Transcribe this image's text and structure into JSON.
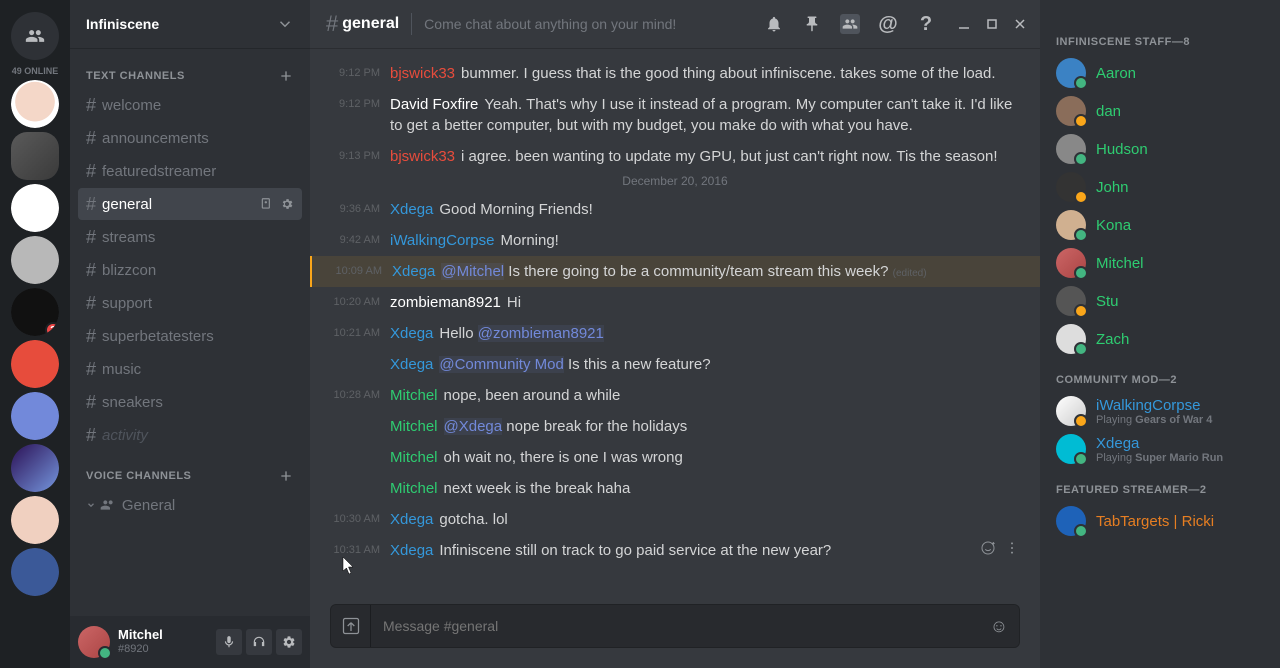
{
  "colors": {
    "role_staff": "#2ecc71",
    "role_mod": "#3498db",
    "role_red": "#e74c3c",
    "role_white": "#ffffff",
    "role_teal": "#1abc9c",
    "role_featured": "#e67e22"
  },
  "server_bar": {
    "online_label": "49 ONLINE",
    "servers": [
      {
        "id": "home",
        "color": "#2e3136",
        "is_home": true
      },
      {
        "id": "isaac",
        "color": "radial-gradient(circle at 50% 45%, #f4d7c8 55%, #fff 56%)",
        "active": false
      },
      {
        "id": "infiniscene",
        "color": "linear-gradient(135deg, #5a5a5a, #3a3a3a)",
        "active": true
      },
      {
        "id": "filthy",
        "color": "#ffffff"
      },
      {
        "id": "asharias",
        "color": "#b8b8b8"
      },
      {
        "id": "moon",
        "color": "#111",
        "badge": "2"
      },
      {
        "id": "axe",
        "color": "#e74c3c"
      },
      {
        "id": "partner",
        "color": "#7289da"
      },
      {
        "id": "galaxy",
        "color": "linear-gradient(135deg, #2b1055, #7597de)"
      },
      {
        "id": "eyes",
        "color": "#f0d0c0"
      },
      {
        "id": "blue",
        "color": "#3b5998"
      }
    ]
  },
  "channel_panel": {
    "server_name": "Infiniscene",
    "text_label": "TEXT CHANNELS",
    "voice_label": "VOICE CHANNELS",
    "channels": [
      {
        "name": "welcome"
      },
      {
        "name": "announcements"
      },
      {
        "name": "featuredstreamer"
      },
      {
        "name": "general",
        "active": true
      },
      {
        "name": "streams"
      },
      {
        "name": "blizzcon"
      },
      {
        "name": "support"
      },
      {
        "name": "superbetatesters"
      },
      {
        "name": "music"
      },
      {
        "name": "sneakers"
      },
      {
        "name": "activity",
        "muted": true
      }
    ],
    "voice_channels": [
      {
        "name": "General"
      }
    ],
    "user": {
      "name": "Mitchel",
      "tag": "#8920"
    }
  },
  "chat_header": {
    "channel": "general",
    "topic": "Come chat about anything on your mind!"
  },
  "messages": [
    {
      "time": "9:12 PM",
      "author": "bjswick33",
      "color": "role_red",
      "text": "bummer.   I guess that is the good thing about infiniscene.  takes some of the load."
    },
    {
      "time": "9:12 PM",
      "author": "David Foxfire",
      "color": "role_white",
      "text": "Yeah.  That's why I use it instead of a program.  My computer can't take it.  I'd like to get a better computer, but with my budget, you make do with what you have."
    },
    {
      "time": "9:13 PM",
      "author": "bjswick33",
      "color": "role_red",
      "text": "i agree.  been wanting to update my GPU, but just can't right now.  Tis the season!"
    },
    {
      "divider": "December 20, 2016"
    },
    {
      "time": "9:36 AM",
      "author": "Xdega",
      "color": "role_mod",
      "text": "Good Morning Friends!"
    },
    {
      "time": "9:42 AM",
      "author": "iWalkingCorpse",
      "color": "role_mod",
      "text": "Morning!"
    },
    {
      "time": "10:09 AM",
      "author": "Xdega",
      "color": "role_mod",
      "mention": "@Mitchel",
      "text": " Is there going to be a community/team stream this week?",
      "edited": true,
      "highlight": true
    },
    {
      "time": "10:20 AM",
      "author": "zombieman8921",
      "color": "role_white",
      "text": "Hi"
    },
    {
      "time": "10:21 AM",
      "author": "Xdega",
      "color": "role_mod",
      "text": "Hello ",
      "mention_after": "@zombieman8921"
    },
    {
      "time": "",
      "author": "Xdega",
      "color": "role_mod",
      "mention": "@Community Mod",
      "text": " Is this a new feature?"
    },
    {
      "time": "10:28 AM",
      "author": "Mitchel",
      "color": "role_staff",
      "text": "nope, been around a while"
    },
    {
      "time": "",
      "author": "Mitchel",
      "color": "role_staff",
      "mention": "@Xdega",
      "text": " nope break for the holidays"
    },
    {
      "time": "",
      "author": "Mitchel",
      "color": "role_staff",
      "text": "oh wait no, there is one I was wrong"
    },
    {
      "time": "",
      "author": "Mitchel",
      "color": "role_staff",
      "text": "next week is the break haha"
    },
    {
      "time": "10:30 AM",
      "author": "Xdega",
      "color": "role_mod",
      "text": "gotcha. lol"
    },
    {
      "time": "10:31 AM",
      "author": "Xdega",
      "color": "role_mod",
      "text": "Infiniscene still on track to go paid service at the new year?",
      "actions": true
    }
  ],
  "input_placeholder": "Message #general",
  "members": {
    "sections": [
      {
        "title": "INFINISCENE STAFF—8",
        "color": "role_staff",
        "members": [
          {
            "name": "Aaron",
            "avatar": "#3b82c4"
          },
          {
            "name": "dan",
            "avatar": "#8a6d5a",
            "status": "idle"
          },
          {
            "name": "Hudson",
            "avatar": "#888"
          },
          {
            "name": "John",
            "avatar": "#333",
            "status": "idle"
          },
          {
            "name": "Kona",
            "avatar": "#d0b090"
          },
          {
            "name": "Mitchel",
            "avatar": "linear-gradient(135deg, #c66, #a44)"
          },
          {
            "name": "Stu",
            "avatar": "#555",
            "status": "idle"
          },
          {
            "name": "Zach",
            "avatar": "#ddd"
          }
        ]
      },
      {
        "title": "COMMUNITY MOD—2",
        "color": "role_mod",
        "members": [
          {
            "name": "iWalkingCorpse",
            "avatar": "linear-gradient(135deg,#fff,#ccc)",
            "status": "idle",
            "sub_pre": "Playing ",
            "sub_game": "Gears of War 4"
          },
          {
            "name": "Xdega",
            "avatar": "#00bcd4",
            "sub_pre": "Playing ",
            "sub_game": "Super Mario Run"
          }
        ]
      },
      {
        "title": "FEATURED STREAMER—2",
        "color": "role_featured",
        "members": [
          {
            "name": "TabTargets | Ricki",
            "avatar": "#1e62b8"
          }
        ]
      }
    ]
  }
}
